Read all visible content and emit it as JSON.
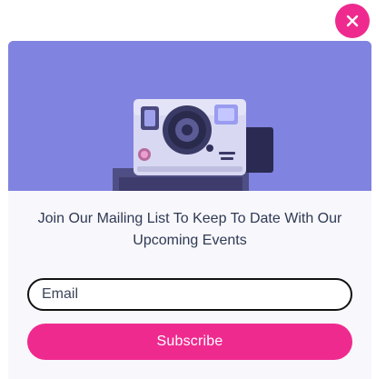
{
  "popup": {
    "close_icon": "close-icon",
    "hero_image_subject": "instant camera photo",
    "heading": "Join Our Mailing List To Keep To Date With Our Upcoming Events",
    "email": {
      "placeholder": "Email",
      "value": ""
    },
    "subscribe_label": "Subscribe"
  },
  "colors": {
    "accent": "#ef2a8f",
    "hero_tint": "#7e80df",
    "heading_text": "#2e3a54",
    "modal_bg": "#f8f7fb"
  }
}
